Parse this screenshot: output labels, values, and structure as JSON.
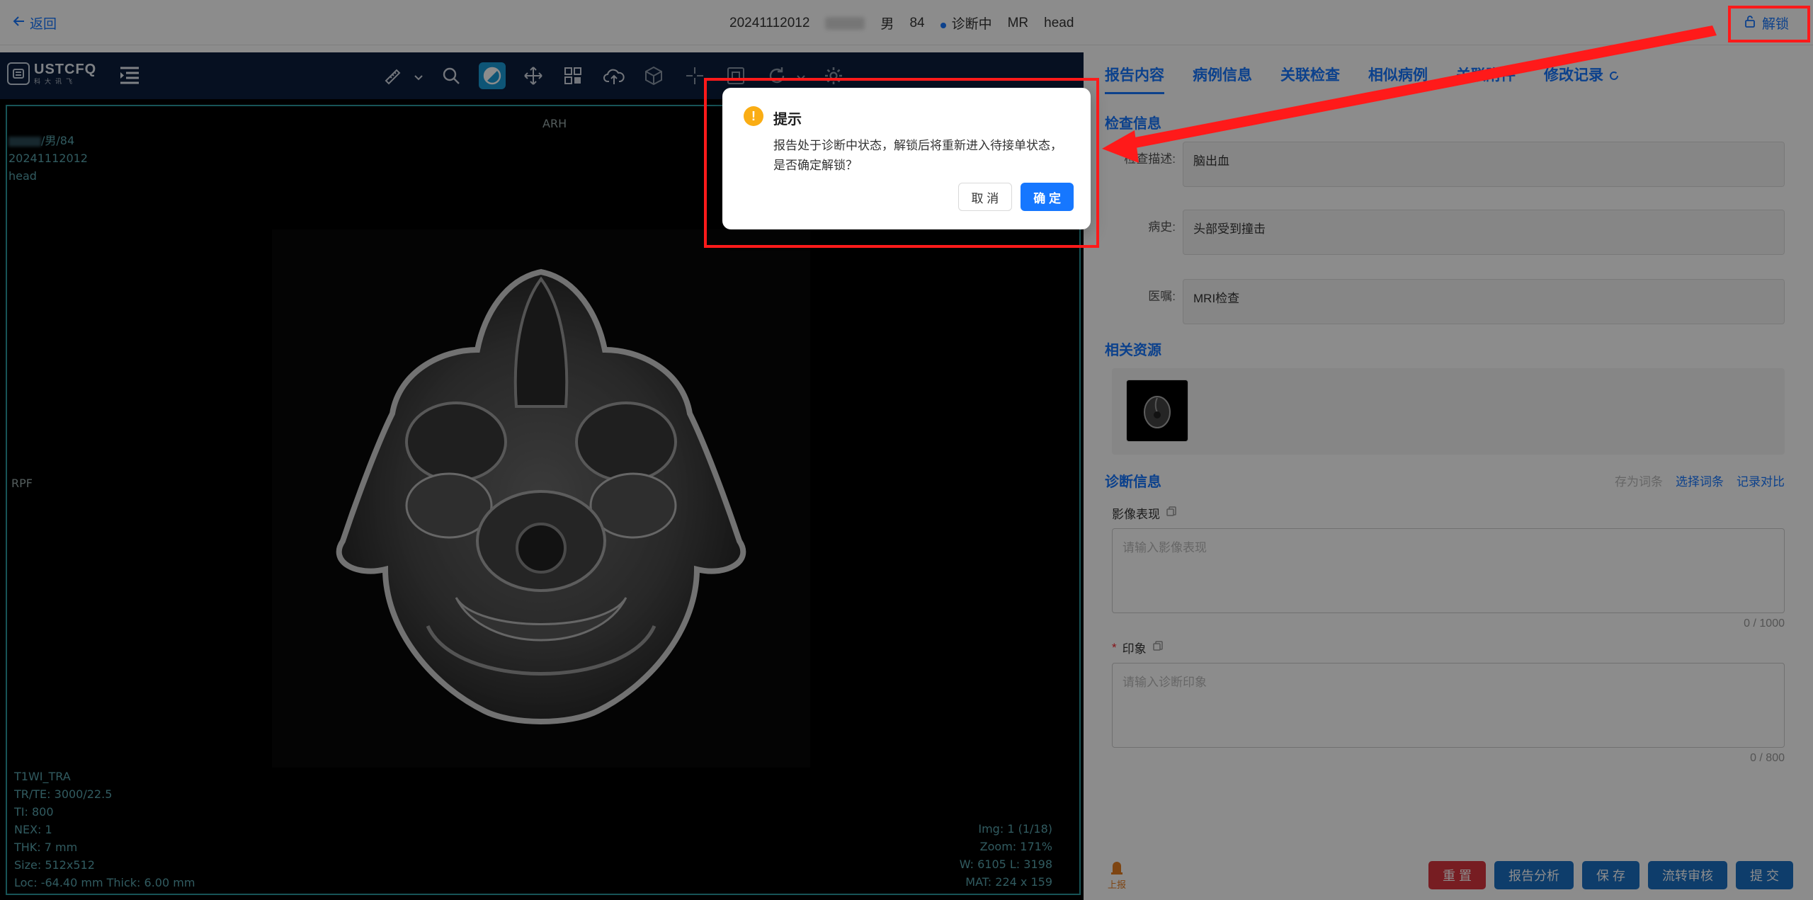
{
  "header": {
    "back_label": "返回",
    "exam_id": "20241112012",
    "sex": "男",
    "age": "84",
    "status": "诊断中",
    "modality": "MR",
    "body_part": "head",
    "unlock_label": "解锁"
  },
  "viewer": {
    "logo_main": "USTCFQ",
    "logo_sub": "科大讯飞",
    "overlay": {
      "patient_line": "/男/84",
      "exam_id": "20241112012",
      "body_part": "head",
      "orient_top": "ARH",
      "orient_left": "RPF",
      "series": "T1WI_TRA",
      "tr_te": "TR/TE: 3000/22.5",
      "ti": "TI: 800",
      "nex": "NEX: 1",
      "thk": "THK: 7 mm",
      "size": "Size: 512x512",
      "loc": "Loc: -64.40 mm Thick: 6.00 mm",
      "img": "Img: 1 (1/18)",
      "zoom": "Zoom: 171%",
      "wl": "W:  6105  L:  3198",
      "mat": "MAT:  224 x 159"
    }
  },
  "panel": {
    "tabs": [
      "报告内容",
      "病例信息",
      "关联检查",
      "相似病例",
      "关联附件",
      "修改记录"
    ],
    "exam_info_title": "检查信息",
    "exam_desc_label": "检查描述:",
    "exam_desc_value": "脑出血",
    "history_label": "病史:",
    "history_value": "头部受到撞击",
    "order_label": "医嘱:",
    "order_value": "MRI检查",
    "resources_title": "相关资源",
    "diagnosis_title": "诊断信息",
    "save_phrase": "存为词条",
    "choose_phrase": "选择词条",
    "compare": "记录对比",
    "findings_label": "影像表现",
    "findings_placeholder": "请输入影像表现",
    "findings_counter": "0 / 1000",
    "impression_label": "印象",
    "impression_placeholder": "请输入诊断印象",
    "impression_counter": "0 / 800",
    "upload_label": "上报",
    "buttons": {
      "reset": "重 置",
      "analysis": "报告分析",
      "save": "保 存",
      "transfer": "流转审核",
      "submit": "提 交"
    }
  },
  "modal": {
    "title": "提示",
    "body": "报告处于诊断中状态，解锁后将重新进入待接单状态，是否确定解锁？",
    "cancel": "取 消",
    "ok": "确 定"
  },
  "colors": {
    "primary": "#1677ff",
    "toolbar_bg": "#0b1e3c",
    "annotation": "#ff1a1a",
    "danger": "#d9363e",
    "warn": "#faad14"
  }
}
